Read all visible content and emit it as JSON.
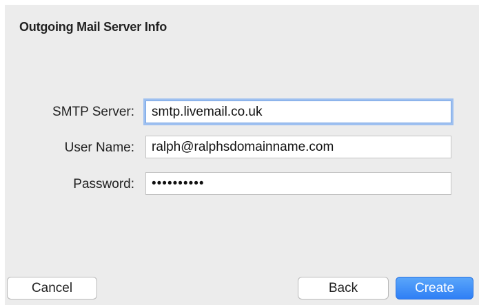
{
  "dialog": {
    "title": "Outgoing Mail Server Info"
  },
  "form": {
    "smtp_server": {
      "label": "SMTP Server:",
      "value": "smtp.livemail.co.uk"
    },
    "user_name": {
      "label": "User Name:",
      "value": "ralph@ralphsdomainname.com"
    },
    "password": {
      "label": "Password:",
      "value": "••••••••••"
    }
  },
  "buttons": {
    "cancel": "Cancel",
    "back": "Back",
    "create": "Create"
  },
  "colors": {
    "focus_ring": "#9ec0f0",
    "primary_button": "#2f7ff5"
  }
}
